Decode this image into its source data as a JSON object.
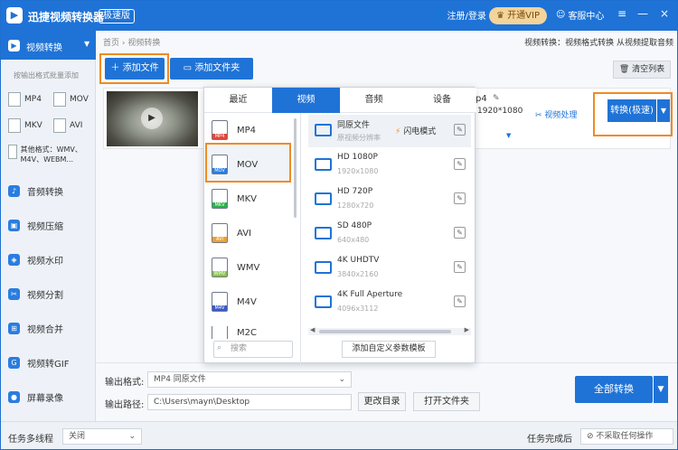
{
  "titlebar": {
    "title": "迅捷视频转换器",
    "badge": "极速版",
    "login": "注册/登录",
    "vip": "开通VIP",
    "service": "客服中心",
    "minimize": "—",
    "close": "×"
  },
  "sidebar": {
    "active": "视频转换",
    "batch_hint": "按输出格式批量添加",
    "formats": [
      "MP4",
      "MOV",
      "MKV",
      "AVI"
    ],
    "other_formats": "其他格式：WMV、M4V、WEBM...",
    "items": [
      {
        "label": "音频转换",
        "icon": "music-icon"
      },
      {
        "label": "视频压缩",
        "icon": "compress-icon"
      },
      {
        "label": "视频水印",
        "icon": "watermark-icon"
      },
      {
        "label": "视频分割",
        "icon": "split-icon"
      },
      {
        "label": "视频合并",
        "icon": "merge-icon"
      },
      {
        "label": "视频转GIF",
        "icon": "gif-icon"
      },
      {
        "label": "屏幕录像",
        "icon": "record-icon"
      }
    ]
  },
  "main": {
    "breadcrumb": "首页 › 视频转换",
    "hint": "视频转换：视频格式转换 从视频提取音频",
    "add_file": "添加文件",
    "add_folder": "添加文件夹",
    "clear_list": "清空列表",
    "file_partial_fmt": "p4",
    "file_resolution": "1920*1080",
    "video_process": "视频处理",
    "convert": "转换(极速)"
  },
  "popup": {
    "tabs": [
      "最近",
      "视频",
      "音频",
      "设备"
    ],
    "active_tab": "视频",
    "formats": [
      "MP4",
      "MOV",
      "MKV",
      "AVI",
      "WMV",
      "M4V",
      "M2C"
    ],
    "selected_format": "MOV",
    "presets": [
      {
        "title": "同原文件",
        "sub": "原视频分辨率",
        "flash": "闪电模式"
      },
      {
        "title": "HD 1080P",
        "sub": "1920x1080"
      },
      {
        "title": "HD 720P",
        "sub": "1280x720"
      },
      {
        "title": "SD 480P",
        "sub": "640x480"
      },
      {
        "title": "4K UHDTV",
        "sub": "3840x2160"
      },
      {
        "title": "4K Full Aperture",
        "sub": "4096x3112"
      }
    ],
    "search_placeholder": "搜索",
    "custom_template": "添加自定义参数模板"
  },
  "bottom": {
    "output_format_label": "输出格式:",
    "output_format_value": "MP4  同原文件",
    "output_path_label": "输出路径:",
    "output_path_value": "C:\\Users\\mayn\\Desktop",
    "change_dir": "更改目录",
    "open_folder": "打开文件夹",
    "convert_all": "全部转换"
  },
  "status": {
    "multi_thread_label": "任务多线程",
    "multi_thread_value": "关闭",
    "after_done_label": "任务完成后",
    "after_done_value": "不采取任何操作"
  },
  "colors": {
    "accent": "#1f73d6",
    "highlight": "#f08a24"
  }
}
